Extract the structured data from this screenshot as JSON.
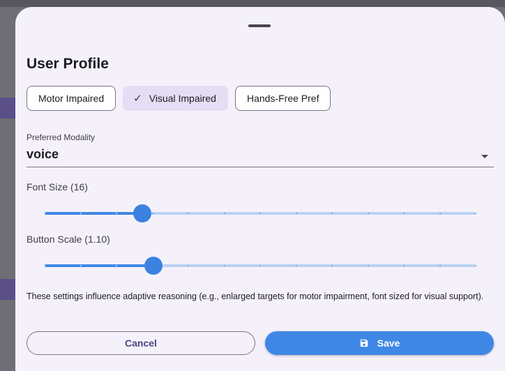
{
  "sheet": {
    "title": "User Profile"
  },
  "chips": [
    {
      "label": "Motor Impaired",
      "selected": false
    },
    {
      "label": "Visual Impaired",
      "selected": true,
      "icon": "check-icon"
    },
    {
      "label": "Hands-Free Pref",
      "selected": false
    }
  ],
  "modality": {
    "label": "Preferred Modality",
    "value": "voice",
    "icon": "arrow-drop-down-icon"
  },
  "font_size": {
    "label": "Font Size (16)",
    "value": 16,
    "position": 0.227,
    "steps": 12
  },
  "button_scale": {
    "label": "Button Scale (1.10)",
    "value": 1.1,
    "position": 0.253,
    "steps": 12
  },
  "help_text": "These settings influence adaptive reasoning (e.g., enlarged targets for motor impairment, font sized for visual support).",
  "actions": {
    "cancel_label": "Cancel",
    "save_label": "Save",
    "save_icon": "save-icon"
  },
  "colors": {
    "accent": "#3f87e5",
    "sheet_background": "#f5f1fb",
    "selected_chip": "#e6ddf4"
  }
}
